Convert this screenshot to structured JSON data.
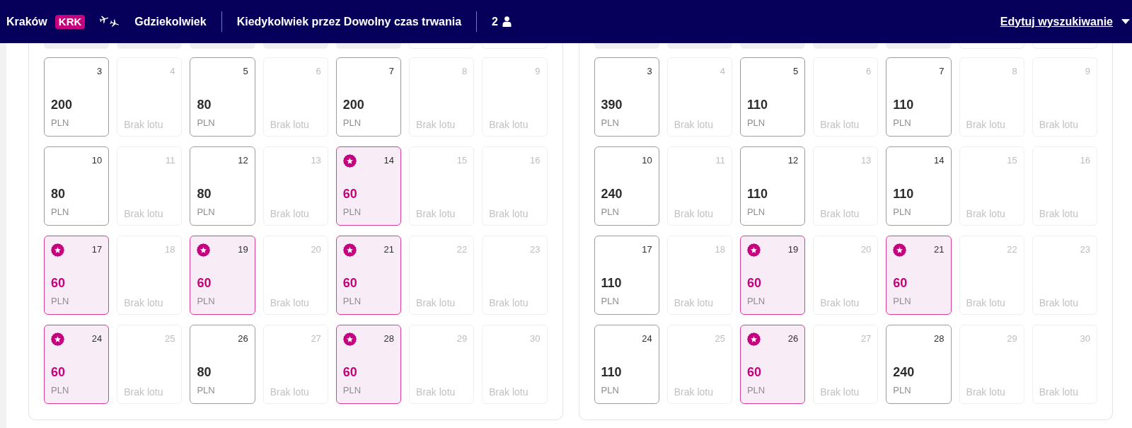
{
  "header": {
    "origin": "Kraków",
    "origin_code": "KRK",
    "destination": "Gdziekolwiek",
    "dates": "Kiedykolwiek przez Dowolny czas trwania",
    "passengers": "2",
    "edit_link": "Edytuj wyszukiwanie"
  },
  "calendars": [
    {
      "partial_row": [
        {
          "kind": "blank"
        },
        {
          "kind": "blank"
        },
        {
          "kind": "blank"
        },
        {
          "kind": "blank"
        },
        {
          "kind": "blank"
        },
        {
          "kind": "day"
        },
        {
          "kind": "day"
        }
      ],
      "days": [
        {
          "kind": "flight",
          "day": "3",
          "price": "200",
          "currency": "PLN",
          "best_price": false
        },
        {
          "kind": "no_flight",
          "day": "4",
          "note": "Brak lotu"
        },
        {
          "kind": "flight",
          "day": "5",
          "price": "80",
          "currency": "PLN",
          "best_price": false
        },
        {
          "kind": "no_flight",
          "day": "6",
          "note": "Brak lotu"
        },
        {
          "kind": "flight",
          "day": "7",
          "price": "200",
          "currency": "PLN",
          "best_price": false
        },
        {
          "kind": "no_flight",
          "day": "8",
          "note": "Brak lotu"
        },
        {
          "kind": "no_flight",
          "day": "9",
          "note": "Brak lotu"
        },
        {
          "kind": "flight",
          "day": "10",
          "price": "80",
          "currency": "PLN",
          "best_price": false
        },
        {
          "kind": "no_flight",
          "day": "11",
          "note": "Brak lotu"
        },
        {
          "kind": "flight",
          "day": "12",
          "price": "80",
          "currency": "PLN",
          "best_price": false
        },
        {
          "kind": "no_flight",
          "day": "13",
          "note": "Brak lotu"
        },
        {
          "kind": "flight",
          "day": "14",
          "price": "60",
          "currency": "PLN",
          "best_price": true
        },
        {
          "kind": "no_flight",
          "day": "15",
          "note": "Brak lotu"
        },
        {
          "kind": "no_flight",
          "day": "16",
          "note": "Brak lotu"
        },
        {
          "kind": "flight",
          "day": "17",
          "price": "60",
          "currency": "PLN",
          "best_price": true
        },
        {
          "kind": "no_flight",
          "day": "18",
          "note": "Brak lotu"
        },
        {
          "kind": "flight",
          "day": "19",
          "price": "60",
          "currency": "PLN",
          "best_price": true
        },
        {
          "kind": "no_flight",
          "day": "20",
          "note": "Brak lotu"
        },
        {
          "kind": "flight",
          "day": "21",
          "price": "60",
          "currency": "PLN",
          "best_price": true
        },
        {
          "kind": "no_flight",
          "day": "22",
          "note": "Brak lotu"
        },
        {
          "kind": "no_flight",
          "day": "23",
          "note": "Brak lotu"
        },
        {
          "kind": "flight",
          "day": "24",
          "price": "60",
          "currency": "PLN",
          "best_price": true
        },
        {
          "kind": "no_flight",
          "day": "25",
          "note": "Brak lotu"
        },
        {
          "kind": "flight",
          "day": "26",
          "price": "80",
          "currency": "PLN",
          "best_price": false
        },
        {
          "kind": "no_flight",
          "day": "27",
          "note": "Brak lotu"
        },
        {
          "kind": "flight",
          "day": "28",
          "price": "60",
          "currency": "PLN",
          "best_price": true
        },
        {
          "kind": "no_flight",
          "day": "29",
          "note": "Brak lotu"
        },
        {
          "kind": "no_flight",
          "day": "30",
          "note": "Brak lotu"
        }
      ]
    },
    {
      "partial_row": [
        {
          "kind": "blank"
        },
        {
          "kind": "blank"
        },
        {
          "kind": "blank"
        },
        {
          "kind": "blank"
        },
        {
          "kind": "blank"
        },
        {
          "kind": "day"
        },
        {
          "kind": "day"
        }
      ],
      "days": [
        {
          "kind": "flight",
          "day": "3",
          "price": "390",
          "currency": "PLN",
          "best_price": false
        },
        {
          "kind": "no_flight",
          "day": "4",
          "note": "Brak lotu"
        },
        {
          "kind": "flight",
          "day": "5",
          "price": "110",
          "currency": "PLN",
          "best_price": false
        },
        {
          "kind": "no_flight",
          "day": "6",
          "note": "Brak lotu"
        },
        {
          "kind": "flight",
          "day": "7",
          "price": "110",
          "currency": "PLN",
          "best_price": false
        },
        {
          "kind": "no_flight",
          "day": "8",
          "note": "Brak lotu"
        },
        {
          "kind": "no_flight",
          "day": "9",
          "note": "Brak lotu"
        },
        {
          "kind": "flight",
          "day": "10",
          "price": "240",
          "currency": "PLN",
          "best_price": false
        },
        {
          "kind": "no_flight",
          "day": "11",
          "note": "Brak lotu"
        },
        {
          "kind": "flight",
          "day": "12",
          "price": "110",
          "currency": "PLN",
          "best_price": false
        },
        {
          "kind": "no_flight",
          "day": "13",
          "note": "Brak lotu"
        },
        {
          "kind": "flight",
          "day": "14",
          "price": "110",
          "currency": "PLN",
          "best_price": false
        },
        {
          "kind": "no_flight",
          "day": "15",
          "note": "Brak lotu"
        },
        {
          "kind": "no_flight",
          "day": "16",
          "note": "Brak lotu"
        },
        {
          "kind": "flight",
          "day": "17",
          "price": "110",
          "currency": "PLN",
          "best_price": false
        },
        {
          "kind": "no_flight",
          "day": "18",
          "note": "Brak lotu"
        },
        {
          "kind": "flight",
          "day": "19",
          "price": "60",
          "currency": "PLN",
          "best_price": true
        },
        {
          "kind": "no_flight",
          "day": "20",
          "note": "Brak lotu"
        },
        {
          "kind": "flight",
          "day": "21",
          "price": "60",
          "currency": "PLN",
          "best_price": true
        },
        {
          "kind": "no_flight",
          "day": "22",
          "note": "Brak lotu"
        },
        {
          "kind": "no_flight",
          "day": "23",
          "note": "Brak lotu"
        },
        {
          "kind": "flight",
          "day": "24",
          "price": "110",
          "currency": "PLN",
          "best_price": false
        },
        {
          "kind": "no_flight",
          "day": "25",
          "note": "Brak lotu"
        },
        {
          "kind": "flight",
          "day": "26",
          "price": "60",
          "currency": "PLN",
          "best_price": true
        },
        {
          "kind": "no_flight",
          "day": "27",
          "note": "Brak lotu"
        },
        {
          "kind": "flight",
          "day": "28",
          "price": "240",
          "currency": "PLN",
          "best_price": false
        },
        {
          "kind": "no_flight",
          "day": "29",
          "note": "Brak lotu"
        },
        {
          "kind": "no_flight",
          "day": "30",
          "note": "Brak lotu"
        }
      ]
    }
  ]
}
